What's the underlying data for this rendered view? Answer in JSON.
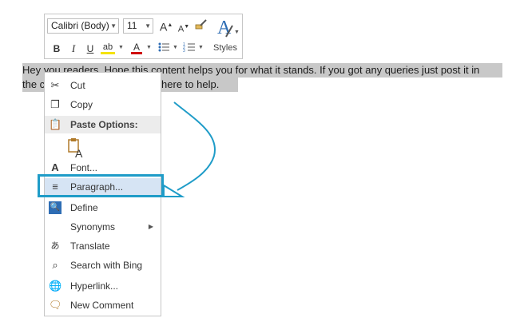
{
  "document": {
    "line1": "Hey you readers. Hope this content helps you for what it stands. If you got any queries just post it in",
    "line2_start": "the c",
    "line2_end": "e here to help."
  },
  "mini_toolbar": {
    "font_name": "Calibri (Body)",
    "font_size": "11",
    "grow_font": "A",
    "shrink_font": "A",
    "bold": "B",
    "italic": "I",
    "underline": "U",
    "highlight": "ab",
    "font_color": "A",
    "styles_label": "Styles",
    "font_color_hex": "#d00000",
    "highlight_hex": "#f5e300"
  },
  "context_menu": {
    "items": [
      {
        "label": "Cut",
        "icon": "scissors-icon"
      },
      {
        "label": "Copy",
        "icon": "copy-icon"
      },
      {
        "label": "Paste Options:",
        "icon": "clipboard-icon"
      },
      {
        "label": "Font...",
        "icon": "font-icon"
      },
      {
        "label": "Paragraph...",
        "icon": "paragraph-icon"
      },
      {
        "label": "Define",
        "icon": "define-icon"
      },
      {
        "label": "Synonyms",
        "icon": ""
      },
      {
        "label": "Translate",
        "icon": "translate-icon"
      },
      {
        "label": "Search with Bing",
        "icon": "search-icon"
      },
      {
        "label": "Hyperlink...",
        "icon": "hyperlink-icon"
      },
      {
        "label": "New Comment",
        "icon": "comment-icon"
      }
    ]
  },
  "colors": {
    "callout": "#1f9cc8",
    "selection": "#c8c8c8",
    "menu_highlight": "#d6e4f4"
  }
}
